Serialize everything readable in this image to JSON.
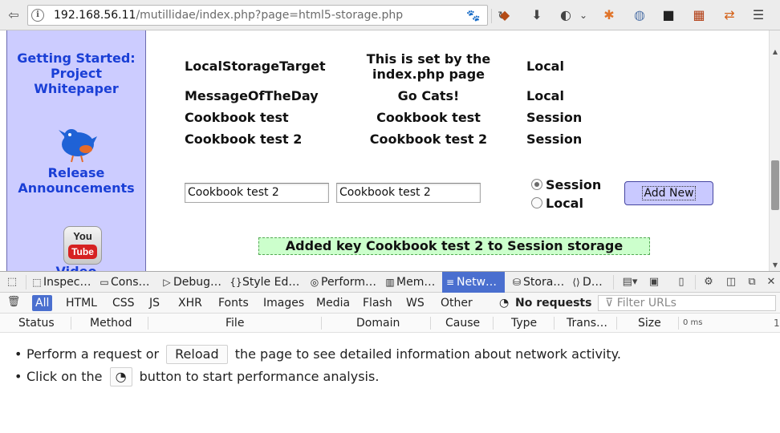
{
  "browser": {
    "url_host": "192.168.56.11",
    "url_path": "/mutillidae/index.php?page=html5-storage.php"
  },
  "sidebar": {
    "getting_started": [
      "Getting Started:",
      "Project",
      "Whitepaper"
    ],
    "release": [
      "Release",
      "Announcements"
    ],
    "youtube_you": "You",
    "youtube_tube": "Tube",
    "video": "Video"
  },
  "storage_table": {
    "rows": [
      {
        "key": "LocalStorageTarget",
        "value": [
          "This is set by the",
          "index.php page"
        ],
        "type": "Local"
      },
      {
        "key": "MessageOfTheDay",
        "value": [
          "Go Cats!"
        ],
        "type": "Local"
      },
      {
        "key": "Cookbook test",
        "value": [
          "Cookbook test"
        ],
        "type": "Session"
      },
      {
        "key": "Cookbook test 2",
        "value": [
          "Cookbook test 2"
        ],
        "type": "Session"
      }
    ]
  },
  "form": {
    "key_value": "Cookbook test 2",
    "value_value": "Cookbook test 2",
    "radio_session": "Session",
    "radio_local": "Local",
    "selected": "Session",
    "add_button": "Add New"
  },
  "status_message": "Added key Cookbook test 2 to Session storage",
  "devtools": {
    "tabs": [
      "Inspec…",
      "Cons…",
      "Debug…",
      "Style Ed…",
      "Perform…",
      "Mem…",
      "Netw…",
      "Stora…",
      "D…"
    ],
    "active_tab": "Netw…",
    "filters": [
      "All",
      "HTML",
      "CSS",
      "JS",
      "XHR",
      "Fonts",
      "Images",
      "Media",
      "Flash",
      "WS",
      "Other"
    ],
    "active_filter": "All",
    "no_requests": "No requests",
    "filter_placeholder": "Filter URLs",
    "columns": [
      "Status",
      "Method",
      "File",
      "Domain",
      "Cause",
      "Type",
      "Trans…",
      "Size"
    ],
    "timeline_label": "0 ms",
    "timeline_tick": "1",
    "hint1_before": "Perform a request or",
    "hint1_button": "Reload",
    "hint1_after": "the page to see detailed information about network activity.",
    "hint2_before": "Click on the",
    "hint2_after": "button to start performance analysis."
  },
  "colors": {
    "sidebar_bg": "#ccccff",
    "link": "#1a3fd6",
    "status_bg": "#ccffcc",
    "active_tab": "#4a6fcf"
  }
}
